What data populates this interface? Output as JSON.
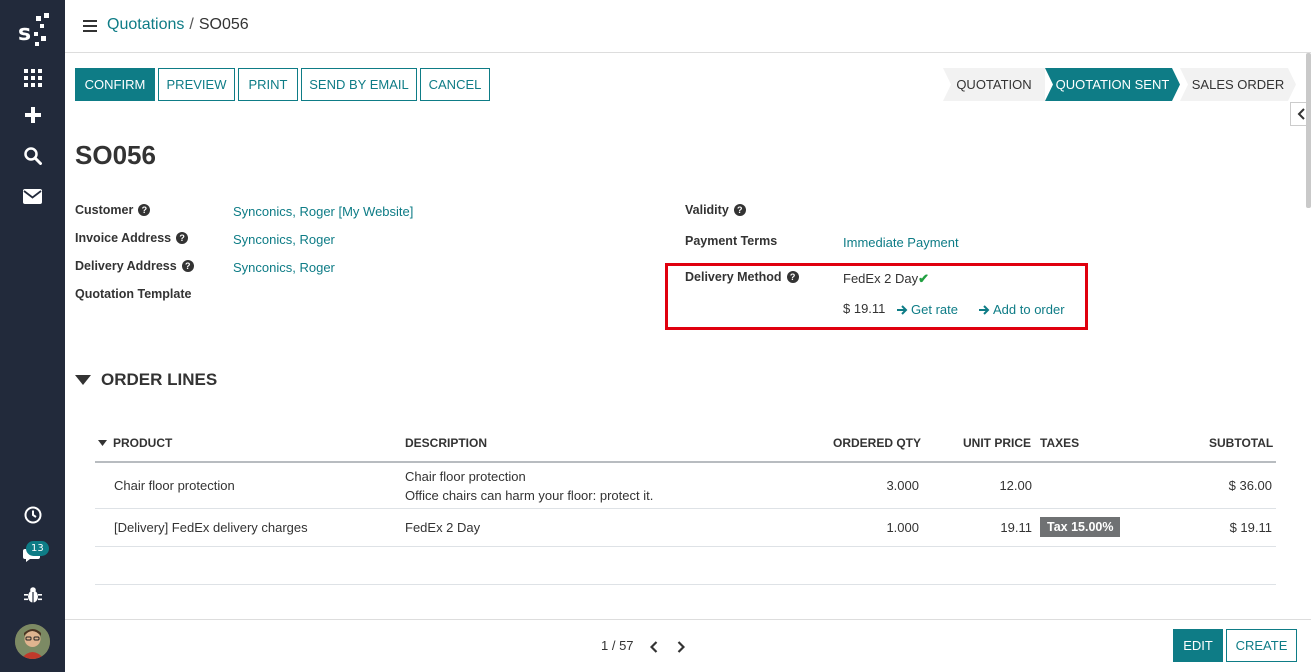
{
  "header": {
    "breadcrumb_parent": "Quotations",
    "breadcrumb_separator": "/",
    "breadcrumb_current": "SO056"
  },
  "toolbar": {
    "confirm": "CONFIRM",
    "preview": "PREVIEW",
    "print": "PRINT",
    "send_by_email": "SEND BY EMAIL",
    "cancel": "CANCEL"
  },
  "statusbar": [
    {
      "label": "QUOTATION",
      "state": "done"
    },
    {
      "label": "QUOTATION SENT",
      "state": "active"
    },
    {
      "label": "SALES ORDER",
      "state": "pending"
    }
  ],
  "record": {
    "title": "SO056",
    "fields_left": [
      {
        "label": "Customer",
        "value": "Synconics, Roger [My Website]",
        "help": true
      },
      {
        "label": "Invoice Address",
        "value": "Synconics, Roger",
        "help": true
      },
      {
        "label": "Delivery Address",
        "value": "Synconics, Roger",
        "help": true
      },
      {
        "label": "Quotation Template",
        "value": "",
        "help": false
      }
    ],
    "fields_right": [
      {
        "label": "Validity",
        "value": "",
        "help": true
      },
      {
        "label": "Payment Terms",
        "value": "Immediate Payment",
        "help": false
      }
    ],
    "delivery": {
      "label": "Delivery Method",
      "carrier": "FedEx 2 Day",
      "rate": "$ 19.11",
      "get_rate": "Get rate",
      "add_to_order": "Add to order"
    }
  },
  "order_lines": {
    "section_title": "ORDER LINES",
    "columns": [
      "PRODUCT",
      "DESCRIPTION",
      "ORDERED QTY",
      "UNIT PRICE",
      "TAXES",
      "SUBTOTAL"
    ],
    "rows": [
      {
        "product": "Chair floor protection",
        "description_line1": "Chair floor protection",
        "description_line2": "Office chairs can harm your floor: protect it.",
        "qty": "3.000",
        "unit_price": "12.00",
        "tax": "",
        "subtotal": "$ 36.00"
      },
      {
        "product": "[Delivery] FedEx delivery charges",
        "description_line1": "FedEx 2 Day",
        "description_line2": "",
        "qty": "1.000",
        "unit_price": "19.11",
        "tax": "Tax 15.00%",
        "subtotal": "$ 19.11"
      }
    ]
  },
  "footer": {
    "pager": "1 / 57",
    "edit": "EDIT",
    "create": "CREATE"
  },
  "sidebar": {
    "notification_count": "13"
  },
  "colors": {
    "brand": "#0e7c86",
    "sidebar_bg": "#222a3b",
    "highlight": "#e0000e",
    "check": "#21a041"
  }
}
